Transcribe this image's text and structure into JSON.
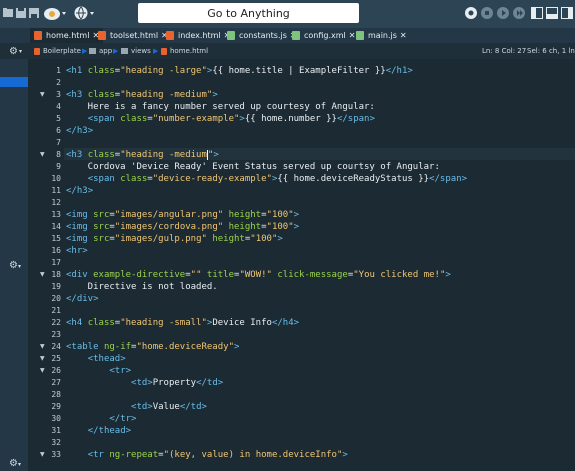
{
  "toolbar": {
    "goto_label": "Go to Anything",
    "icons": [
      "folder-icon",
      "save-icon",
      "save-all-icon",
      "cloud-icon",
      "globe-icon",
      "record-icon",
      "stop-icon",
      "play-icon",
      "play-all-icon",
      "layout-left-icon",
      "layout-bottom-icon",
      "layout-right-icon"
    ]
  },
  "tabs": [
    {
      "label": "home.html",
      "type": "html",
      "active": true
    },
    {
      "label": "toolset.html",
      "type": "html"
    },
    {
      "label": "index.html",
      "type": "html"
    },
    {
      "label": "constants.js",
      "type": "js"
    },
    {
      "label": "config.xml",
      "type": "xml"
    },
    {
      "label": "main.js",
      "type": "js"
    }
  ],
  "breadcrumb": {
    "items": [
      "Boilerplate",
      "app",
      "views",
      "home.html"
    ]
  },
  "status": {
    "position": "Ln: 8 Col: 27",
    "selection": "Sel: 6 ch, 1 ln"
  },
  "editor": {
    "lines": [
      {
        "n": "1",
        "fold": "",
        "text": "<h1 class=\"heading -large\">{{ home.title | ExampleFilter }}</h1>"
      },
      {
        "n": "2",
        "fold": "",
        "text": ""
      },
      {
        "n": "3",
        "fold": "▼",
        "text": "<h3 class=\"heading -medium\">"
      },
      {
        "n": "4",
        "fold": "",
        "text": "    Here is a fancy number served up courtesy of Angular:"
      },
      {
        "n": "5",
        "fold": "",
        "text": "    <span class=\"number-example\">{{ home.number }}</span>"
      },
      {
        "n": "6",
        "fold": "",
        "text": "</h3>"
      },
      {
        "n": "7",
        "fold": "",
        "text": ""
      },
      {
        "n": "8",
        "fold": "▼",
        "text": "<h3 class=\"heading -medium\">"
      },
      {
        "n": "9",
        "fold": "",
        "text": "    Cordova 'Device Ready' Event Status served up courtsy of Angular:"
      },
      {
        "n": "10",
        "fold": "",
        "text": "    <span class=\"device-ready-example\">{{ home.deviceReadyStatus }}</span>"
      },
      {
        "n": "11",
        "fold": "",
        "text": "</h3>"
      },
      {
        "n": "12",
        "fold": "",
        "text": ""
      },
      {
        "n": "13",
        "fold": "",
        "text": "<img src=\"images/angular.png\" height=\"100\">"
      },
      {
        "n": "14",
        "fold": "",
        "text": "<img src=\"images/cordova.png\" height=\"100\">"
      },
      {
        "n": "15",
        "fold": "",
        "text": "<img src=\"images/gulp.png\" height=\"100\">"
      },
      {
        "n": "16",
        "fold": "",
        "text": "<hr>"
      },
      {
        "n": "17",
        "fold": "",
        "text": ""
      },
      {
        "n": "18",
        "fold": "▼",
        "text": "<div example-directive=\"\" title=\"WOW!\" click-message=\"You clicked me!\">"
      },
      {
        "n": "19",
        "fold": "",
        "text": "    Directive is not loaded."
      },
      {
        "n": "20",
        "fold": "",
        "text": "</div>"
      },
      {
        "n": "21",
        "fold": "",
        "text": ""
      },
      {
        "n": "22",
        "fold": "",
        "text": "<h4 class=\"heading -small\">Device Info</h4>"
      },
      {
        "n": "23",
        "fold": "",
        "text": ""
      },
      {
        "n": "24",
        "fold": "▼",
        "text": "<table ng-if=\"home.deviceReady\">"
      },
      {
        "n": "25",
        "fold": "▼",
        "text": "    <thead>"
      },
      {
        "n": "26",
        "fold": "▼",
        "text": "        <tr>"
      },
      {
        "n": "27",
        "fold": "",
        "text": "            <td>Property</td>"
      },
      {
        "n": "28",
        "fold": "",
        "text": ""
      },
      {
        "n": "29",
        "fold": "",
        "text": "            <td>Value</td>"
      },
      {
        "n": "30",
        "fold": "",
        "text": "        </tr>"
      },
      {
        "n": "31",
        "fold": "",
        "text": "    </thead>"
      },
      {
        "n": "32",
        "fold": "",
        "text": ""
      },
      {
        "n": "33",
        "fold": "▼",
        "text": "    <tr ng-repeat=\"(key, value) in home.deviceInfo\">"
      }
    ]
  }
}
